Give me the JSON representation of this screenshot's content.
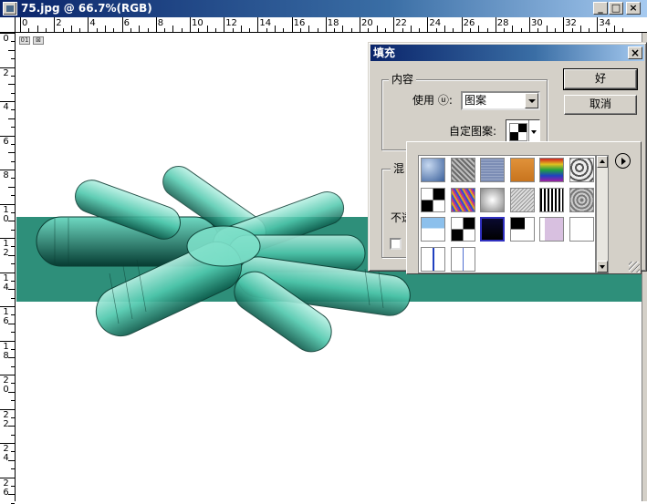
{
  "window": {
    "title": "75.jpg @ 66.7%(RGB)",
    "minimize": "_",
    "maximize": "□",
    "close": "×"
  },
  "ruler": {
    "top_labels": [
      "0",
      "2",
      "4",
      "6",
      "8",
      "10",
      "12",
      "14",
      "16",
      "18",
      "20",
      "22",
      "24",
      "26",
      "28",
      "30",
      "32",
      "34"
    ],
    "left_labels": [
      "0",
      "2",
      "4",
      "6",
      "8",
      "1\n0",
      "1\n2",
      "1\n4",
      "1\n6",
      "1\n8",
      "2\n0",
      "2\n2",
      "2\n4",
      "2\n6"
    ]
  },
  "canvas": {
    "band_color": "#2e8f7a",
    "mini_icons": [
      "01",
      "⊠"
    ]
  },
  "fill_dialog": {
    "title": "填充",
    "close": "×",
    "content_group": "内容",
    "use_label": "使用 ⓤ:",
    "use_value": "图案",
    "custom_pattern_label": "自定图案:",
    "blend_group_partial": "混",
    "opacity_partial": "不透",
    "ok": "好",
    "cancel": "取消"
  },
  "pattern_picker": {
    "swatches": [
      {
        "name": "bubbles-pattern",
        "bg": "radial-gradient(circle at 30% 30%, #c6d8f0, #3a5f9a)"
      },
      {
        "name": "noise-gray-pattern",
        "bg": "repeating-linear-gradient(45deg, #6a6a6a 0 2px, #bdbdbd 2px 4px)"
      },
      {
        "name": "blue-texture-pattern",
        "bg": "repeating-linear-gradient(0deg, #7c8db5 0 2px, #9aa8c8 2px 3px)"
      },
      {
        "name": "orange-pattern",
        "bg": "linear-gradient(#e0923a, #c8741e)"
      },
      {
        "name": "rainbow-pattern",
        "bg": "linear-gradient(#d02020, #e0c020, #20a040, #2040c0, #a020a0)"
      },
      {
        "name": "marble-pattern",
        "bg": "repeating-radial-gradient(circle at 40% 40%, #eee 0 3px, #555 3px 5px)"
      },
      {
        "name": "checker-pattern",
        "bg": "repeating-conic-gradient(#000 0 25%, #fff 0 50%)"
      },
      {
        "name": "confetti-pattern",
        "bg": "repeating-linear-gradient(60deg, #c03090 0 2px, #3050d0 2px 4px, #e0a020 4px 6px)"
      },
      {
        "name": "clouds-pattern",
        "bg": "radial-gradient(circle at 50% 50%, #fff, #888)"
      },
      {
        "name": "granite-pattern",
        "bg": "repeating-linear-gradient(135deg, #999 0 1px, #ddd 1px 3px)"
      },
      {
        "name": "stripes-pattern",
        "bg": "repeating-linear-gradient(90deg, #000 0 2px, #fff 2px 4px)"
      },
      {
        "name": "gray-noise-pattern",
        "bg": "repeating-radial-gradient(circle, #777 0 2px, #ccc 2px 4px)"
      },
      {
        "name": "lightblue-white-pattern",
        "bg": "linear-gradient(#8cc0ec 0 45%, #fff 45%)"
      },
      {
        "name": "bw-quad-pattern",
        "bg": "conic-gradient(#000 0 25%, #fff 0 50%, #000 0 75%, #fff 0)"
      },
      {
        "name": "navy-pattern",
        "bg": "linear-gradient(#0a0a30, #000)"
      },
      {
        "name": "black-corner-pattern",
        "bg": "conic-gradient(from 270deg at 60% 50%, #000 0 25%, #fff 0)"
      },
      {
        "name": "lavender-pattern",
        "bg": "linear-gradient(90deg, #fff 0 20%, #d8c0e0 20%)"
      },
      {
        "name": "lavender-frame-pattern",
        "bg": "linear-gradient(#fff, #fff) padding-box, #c8b0d8"
      },
      {
        "name": "dotted-blue-line-pattern",
        "bg": "linear-gradient(90deg, #fff 0 48%, #2040c0 48% 56%, #fff 56%)"
      },
      {
        "name": "dotted-line-pattern",
        "bg": "linear-gradient(90deg, #fff 0 48%, #5070d0 48% 52%, #fff 52%)"
      }
    ]
  }
}
